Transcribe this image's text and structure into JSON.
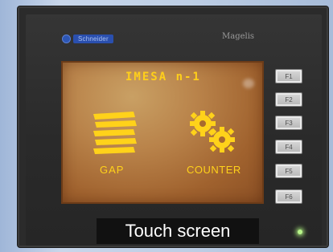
{
  "header": {
    "brand_badge_text": "Schneider",
    "brand_name": "Magelis"
  },
  "screen": {
    "title": "IMESA n-1",
    "items": [
      {
        "label": "GAP",
        "icon": "spring-coils-icon"
      },
      {
        "label": "COUNTER",
        "icon": "gears-icon"
      }
    ]
  },
  "function_keys": [
    "F1",
    "F2",
    "F3",
    "F4",
    "F5",
    "F6"
  ],
  "caption": "Touch screen",
  "colors": {
    "screen_bg": "#b9834a",
    "screen_text": "#ffd21a",
    "bezel": "#2a2a2a",
    "caption_bg": "#111111",
    "caption_text": "#ffffff",
    "led": "#b8f58a"
  }
}
